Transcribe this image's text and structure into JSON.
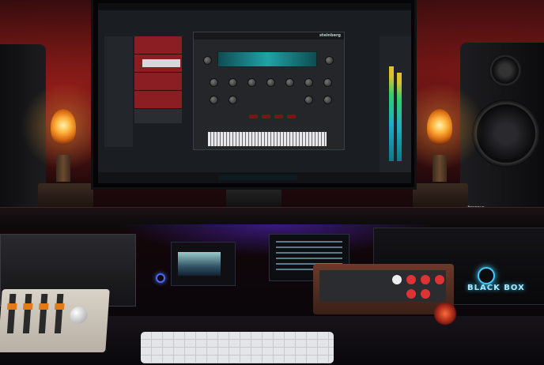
{
  "plugin": {
    "brand": "steinberg"
  },
  "rack_logo": {
    "text": "BLACK BOX"
  },
  "speaker_badge": {
    "text": "Presonus"
  },
  "colors": {
    "wall_red": "#3b0d10",
    "lamp_amber": "#ffb640",
    "daw_track_red": "#8b1e22",
    "waveform_teal": "#1fa3a6",
    "underlight_purple": "#5a28dc",
    "rack_glow_cyan": "#aee8ff"
  }
}
